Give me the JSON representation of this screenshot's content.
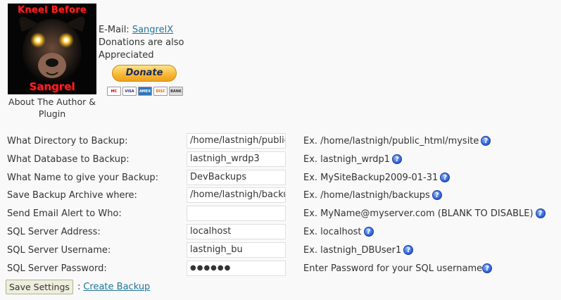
{
  "author": {
    "banner_top": "Kneel Before",
    "banner_bottom": "Sangrel",
    "caption": "About The Author & Plugin"
  },
  "contact": {
    "email_label": "E-Mail:",
    "email_link": "SangrelX",
    "donations_text": "Donations are also Appreciated",
    "donate_label": "Donate",
    "cards": [
      "MC",
      "VISA",
      "AMEX",
      "DISC",
      "BANK"
    ]
  },
  "form": {
    "rows": [
      {
        "label": "What Directory to Backup:",
        "value": "/home/lastnigh/public_html/mysite",
        "hint": "Ex. /home/lastnigh/public_html/mysite"
      },
      {
        "label": "What Database to Backup:",
        "value": "lastnigh_wrdp3",
        "hint": "Ex. lastnigh_wrdp1"
      },
      {
        "label": "What Name to give your Backup:",
        "value": "DevBackups",
        "hint": "Ex. MySiteBackup2009-01-31"
      },
      {
        "label": "Save Backup Archive where:",
        "value": "/home/lastnigh/backups",
        "hint": "Ex. /home/lastnigh/backups"
      },
      {
        "label": "Send Email Alert to Who:",
        "value": "",
        "hint": "Ex. MyName@myserver.com (BLANK TO DISABLE)"
      },
      {
        "label": "SQL Server Address:",
        "value": "localhost",
        "hint": "Ex. localhost"
      },
      {
        "label": "SQL Server Username:",
        "value": "lastnigh_bu",
        "hint": "Ex. lastnigh_DBUser1"
      },
      {
        "label": "SQL Server Password:",
        "value": "●●●●●●",
        "hint": "Enter Password for your SQL username"
      }
    ],
    "help_glyph": "?"
  },
  "actions": {
    "save_label": "Save Settings",
    "separator": ":",
    "create_link": "Create Backup"
  }
}
